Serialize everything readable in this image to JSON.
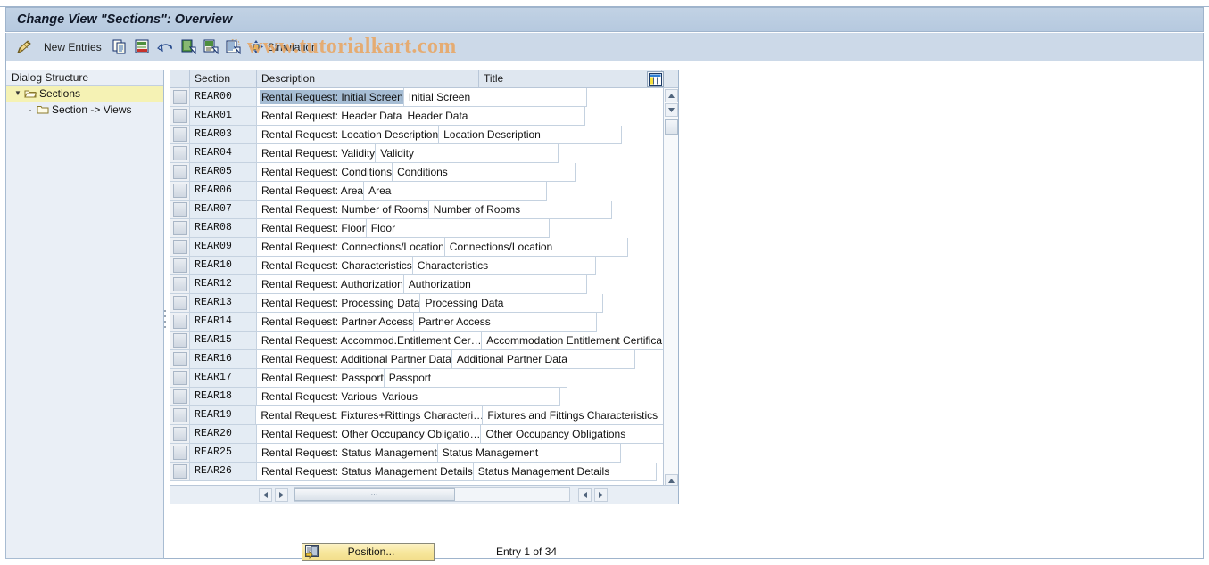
{
  "window": {
    "title": "Change View \"Sections\": Overview"
  },
  "watermark": {
    "text": "www.tutorialkart.com",
    "color": "#e8a96a"
  },
  "toolbar": {
    "items": [
      {
        "icon": "pencil-display-change-icon",
        "label": ""
      },
      {
        "icon": "",
        "label": "New Entries"
      },
      {
        "icon": "copy-icon",
        "label": ""
      },
      {
        "icon": "delete-row-icon",
        "label": ""
      },
      {
        "icon": "undo-icon",
        "label": ""
      },
      {
        "icon": "select-all-icon",
        "label": ""
      },
      {
        "icon": "deselect-all-icon",
        "label": ""
      },
      {
        "icon": "select-block-icon",
        "label": ""
      },
      {
        "icon": "simulation-icon",
        "label": "Simulation"
      }
    ],
    "new_entries_label": "New Entries",
    "simulation_label": "Simulation"
  },
  "dialog_structure": {
    "header": "Dialog Structure",
    "items": [
      {
        "label": "Sections",
        "icon": "open-folder-icon",
        "expanded": true,
        "selected": true,
        "level": 0
      },
      {
        "label": "Section -> Views",
        "icon": "folder-icon",
        "expanded": false,
        "selected": false,
        "level": 1
      }
    ]
  },
  "table": {
    "config_icon": "table-settings-icon",
    "columns": [
      {
        "key": "section",
        "label": "Section"
      },
      {
        "key": "description",
        "label": "Description"
      },
      {
        "key": "title",
        "label": "Title"
      }
    ],
    "selected_row_index": 0,
    "selected_cell_column": "description",
    "rows": [
      {
        "section": "REAR00",
        "description": "Rental Request: Initial Screen",
        "title": "Initial Screen"
      },
      {
        "section": "REAR01",
        "description": "Rental Request: Header Data",
        "title": "Header Data"
      },
      {
        "section": "REAR03",
        "description": "Rental Request: Location Description",
        "title": "Location Description"
      },
      {
        "section": "REAR04",
        "description": "Rental Request: Validity",
        "title": "Validity"
      },
      {
        "section": "REAR05",
        "description": "Rental Request: Conditions",
        "title": "Conditions"
      },
      {
        "section": "REAR06",
        "description": "Rental Request: Area",
        "title": "Area"
      },
      {
        "section": "REAR07",
        "description": "Rental Request: Number of Rooms",
        "title": "Number of Rooms"
      },
      {
        "section": "REAR08",
        "description": "Rental Request: Floor",
        "title": "Floor"
      },
      {
        "section": "REAR09",
        "description": "Rental Request: Connections/Location",
        "title": "Connections/Location"
      },
      {
        "section": "REAR10",
        "description": "Rental Request: Characteristics",
        "title": "Characteristics"
      },
      {
        "section": "REAR12",
        "description": "Rental Request: Authorization",
        "title": "Authorization"
      },
      {
        "section": "REAR13",
        "description": "Rental Request: Processing Data",
        "title": "Processing Data"
      },
      {
        "section": "REAR14",
        "description": "Rental Request: Partner Access",
        "title": "Partner Access"
      },
      {
        "section": "REAR15",
        "description": "Rental Request: Accommod.Entitlement Cer…",
        "title": "Accommodation Entitlement Certifica"
      },
      {
        "section": "REAR16",
        "description": "Rental Request: Additional Partner Data",
        "title": "Additional Partner Data"
      },
      {
        "section": "REAR17",
        "description": "Rental Request: Passport",
        "title": "Passport"
      },
      {
        "section": "REAR18",
        "description": "Rental Request: Various",
        "title": "Various"
      },
      {
        "section": "REAR19",
        "description": "Rental Request: Fixtures+Rittings Characteri…",
        "title": "Fixtures and Fittings Characteristics"
      },
      {
        "section": "REAR20",
        "description": "Rental Request: Other Occupancy Obligatio…",
        "title": "Other Occupancy Obligations"
      },
      {
        "section": "REAR25",
        "description": "Rental Request: Status Management",
        "title": "Status Management"
      },
      {
        "section": "REAR26",
        "description": "Rental Request: Status Management Details",
        "title": "Status Management Details"
      }
    ]
  },
  "footer": {
    "position_button_label": "Position...",
    "position_button_icon": "position-icon",
    "entry_count": "Entry 1 of 34"
  }
}
